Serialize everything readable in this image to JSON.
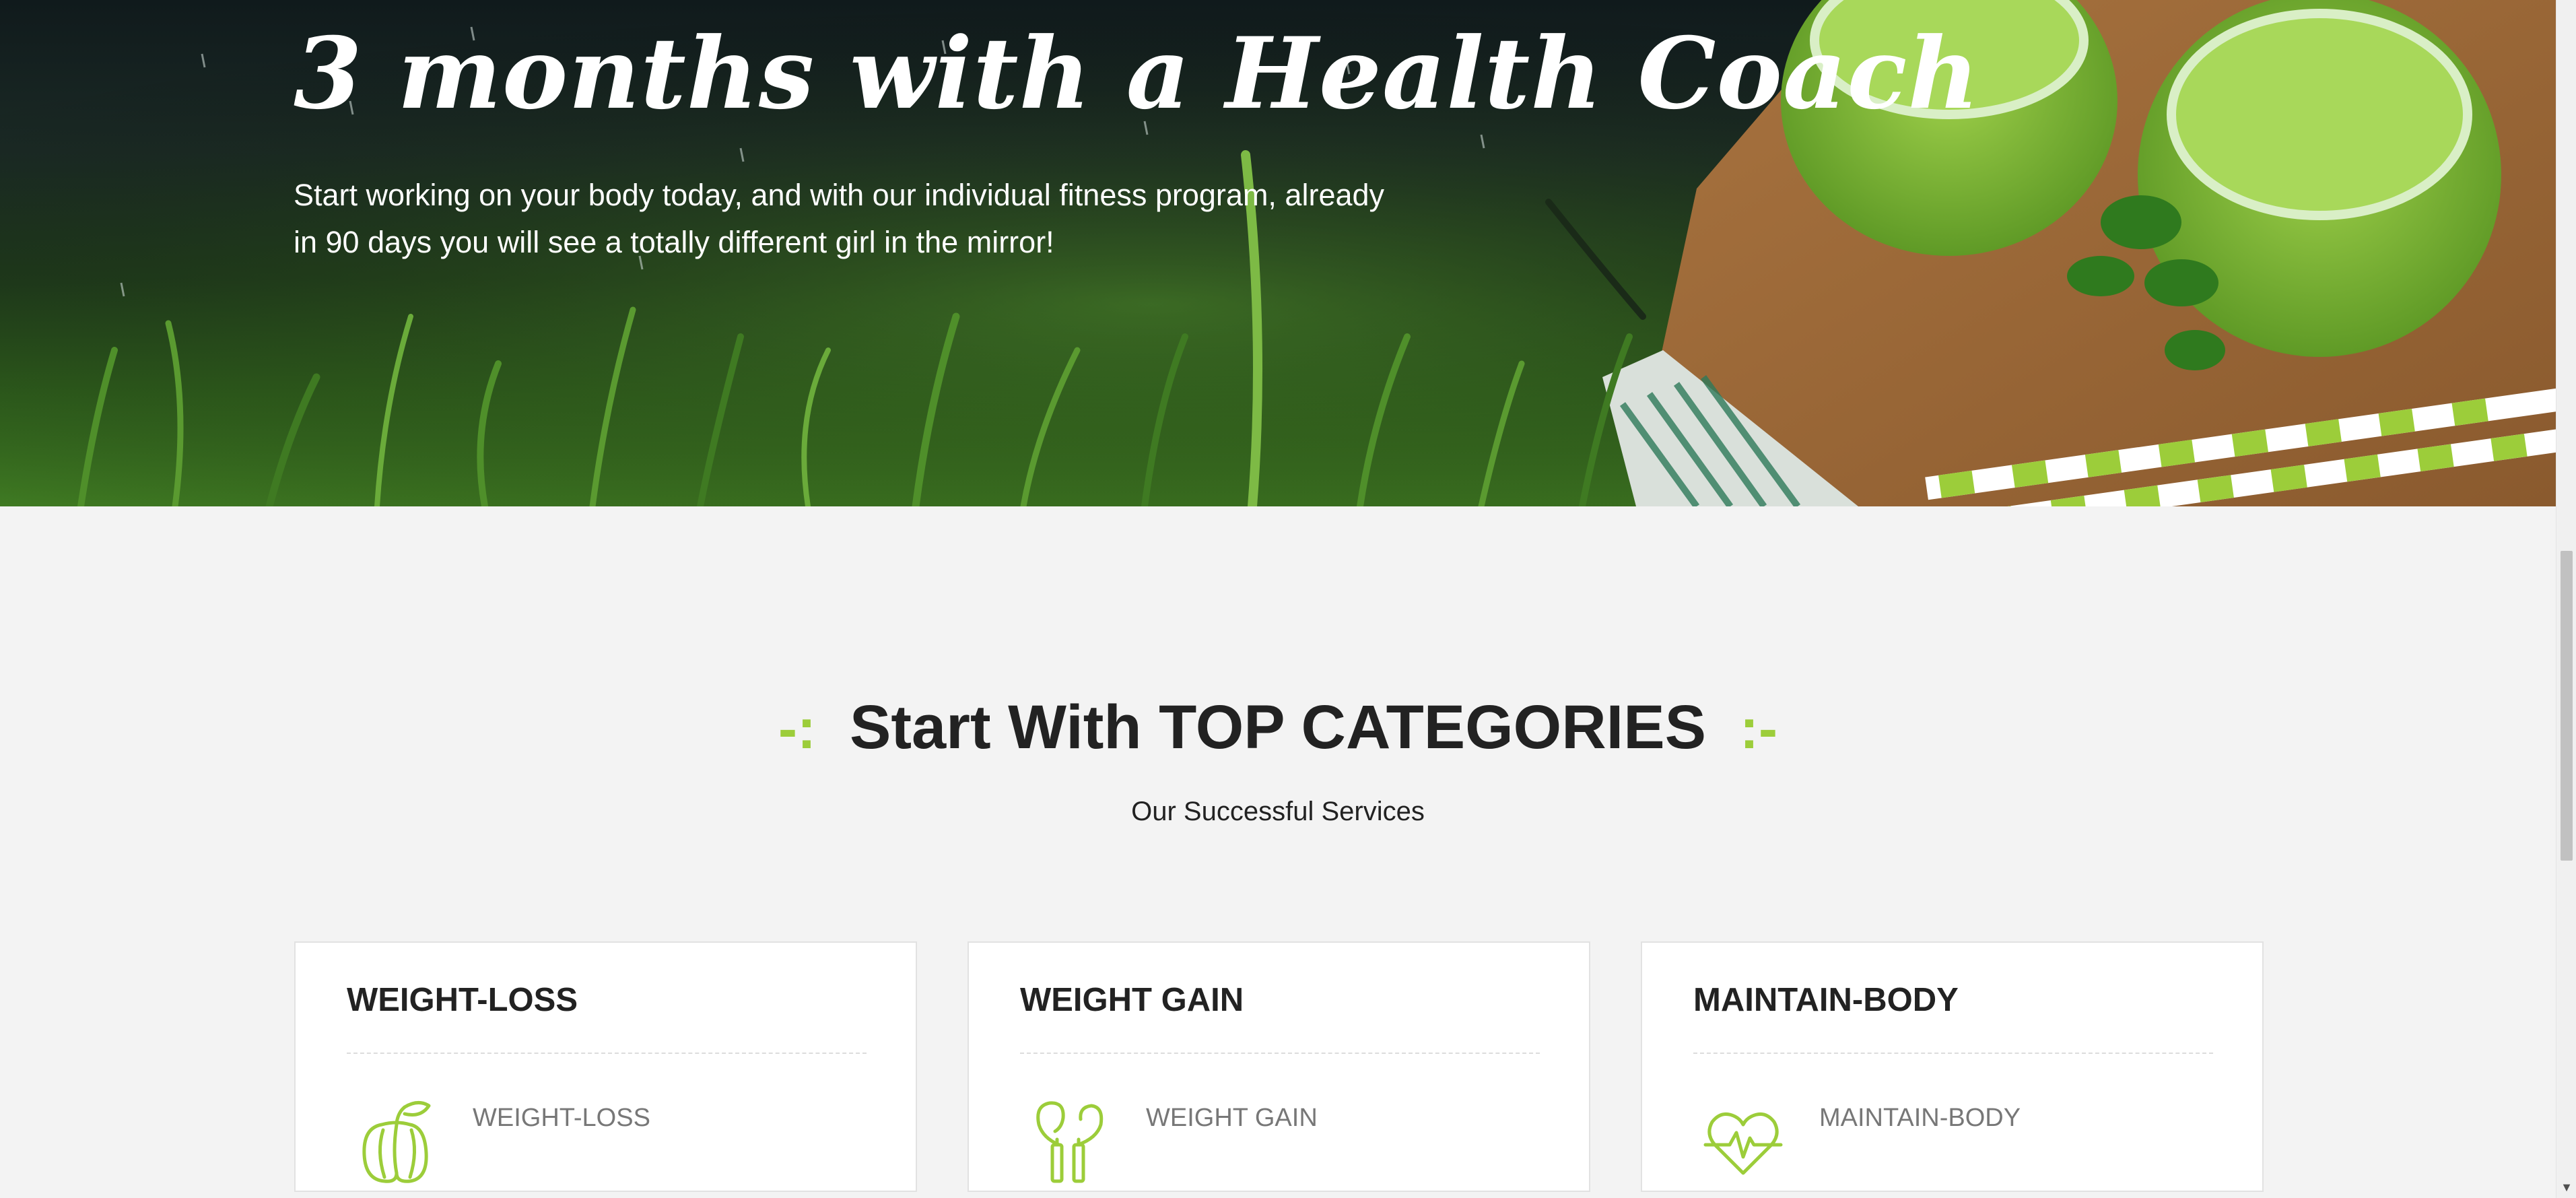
{
  "hero": {
    "title": "3 months with a Health Coach",
    "text": "Start working on your body today, and with our individual fitness program, already in 90 days you will see a totally different girl in the mirror!"
  },
  "section": {
    "deco_left": "-:",
    "title_prefix": "Start With",
    "title_strong": "TOP CATEGORIES",
    "deco_right": ":-",
    "subtitle": "Our Successful Services"
  },
  "cards": [
    {
      "title": "WEIGHT-LOSS",
      "label": "WEIGHT-LOSS",
      "icon": "pepper-icon"
    },
    {
      "title": "WEIGHT GAIN",
      "label": "WEIGHT GAIN",
      "icon": "jump-rope-icon"
    },
    {
      "title": "MAINTAIN-BODY",
      "label": "MAINTAIN-BODY",
      "icon": "heartbeat-icon"
    }
  ],
  "scrollbar": {
    "arrow": "▼"
  },
  "colors": {
    "accent": "#9ccd3a",
    "text": "#222222",
    "muted": "#777777",
    "background": "#f3f3f3"
  }
}
